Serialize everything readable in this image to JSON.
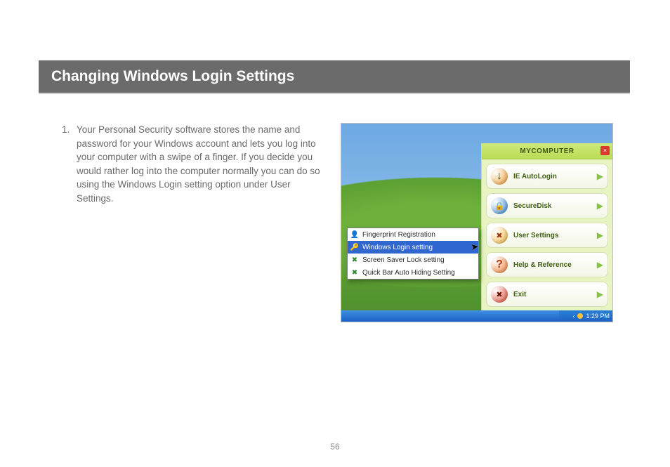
{
  "title": "Changing Windows Login Settings",
  "step_number": "1.",
  "step_text": "Your Personal Security software stores the name and password for your Windows account and lets you log into your computer with a swipe of a finger.  If you decide you would rather log into the computer normally you can do so using the Windows Login setting option under User Settings.",
  "page_number": "56",
  "screenshot": {
    "sidebar_title": "MYCOMPUTER",
    "sidebar_items": [
      {
        "label": "IE AutoLogin",
        "icon_color": "#f39c2c",
        "glyph": "↓"
      },
      {
        "label": "SecureDisk",
        "icon_color": "#2f87d6",
        "glyph": "🔒"
      },
      {
        "label": "User Settings",
        "icon_color": "#f3b536",
        "glyph": "✖"
      },
      {
        "label": "Help & Reference",
        "icon_color": "#f37a2c",
        "glyph": "?"
      },
      {
        "label": "Exit",
        "icon_color": "#e0432b",
        "glyph": "✖"
      }
    ],
    "context_menu": [
      {
        "label": "Fingerprint Registration",
        "icon": "👤",
        "selected": false
      },
      {
        "label": "Windows Login setting",
        "icon": "🔑",
        "selected": true
      },
      {
        "label": "Screen Saver Lock setting",
        "icon": "✖",
        "selected": false
      },
      {
        "label": "Quick Bar Auto Hiding Setting",
        "icon": "✖",
        "selected": false
      }
    ],
    "clock": "1:29 PM"
  }
}
